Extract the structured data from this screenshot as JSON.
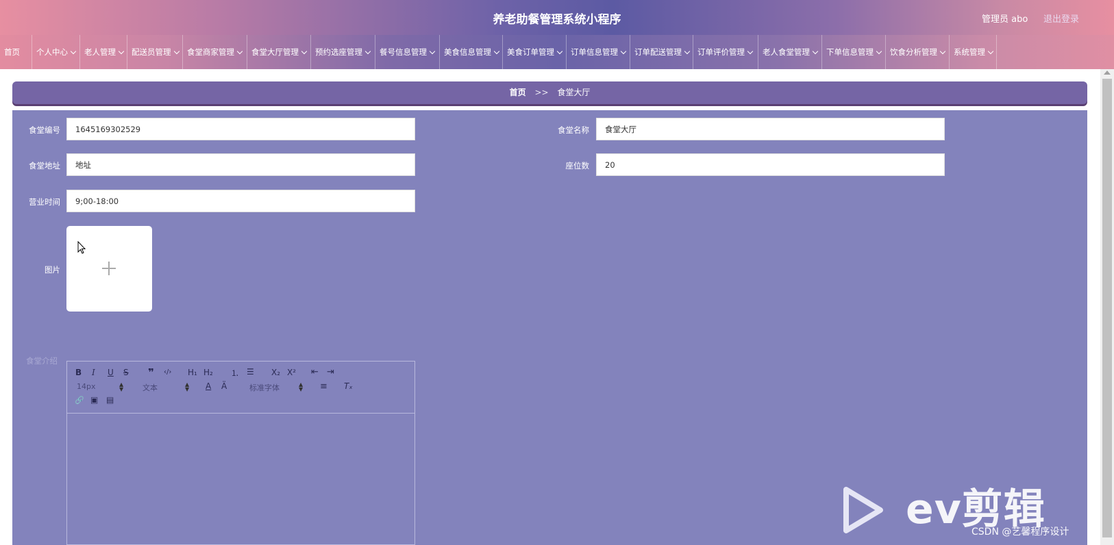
{
  "header": {
    "title": "养老助餐管理系统小程序",
    "user": "管理员 abo",
    "logout": "退出登录"
  },
  "nav": {
    "items": [
      {
        "label": "首页",
        "chevron": false
      },
      {
        "label": "个人中心",
        "chevron": true
      },
      {
        "label": "老人管理",
        "chevron": true
      },
      {
        "label": "配送员管理",
        "chevron": true
      },
      {
        "label": "食堂商家管理",
        "chevron": true
      },
      {
        "label": "食堂大厅管理",
        "chevron": true
      },
      {
        "label": "预约选座管理",
        "chevron": true
      },
      {
        "label": "餐号信息管理",
        "chevron": true
      },
      {
        "label": "美食信息管理",
        "chevron": true
      },
      {
        "label": "美食订单管理",
        "chevron": true
      },
      {
        "label": "订单信息管理",
        "chevron": true
      },
      {
        "label": "订单配送管理",
        "chevron": true
      },
      {
        "label": "订单评价管理",
        "chevron": true
      },
      {
        "label": "老人食堂管理",
        "chevron": true
      },
      {
        "label": "下单信息管理",
        "chevron": true
      },
      {
        "label": "饮食分析管理",
        "chevron": true
      },
      {
        "label": "系统管理",
        "chevron": true
      }
    ]
  },
  "breadcrumb": {
    "home": "首页",
    "sep": ">>",
    "current": "食堂大厅"
  },
  "form": {
    "canteen_no_label": "食堂编号",
    "canteen_no": "1645169302529",
    "canteen_name_label": "食堂名称",
    "canteen_name": "食堂大厅",
    "address_label": "食堂地址",
    "address": "地址",
    "seats_label": "座位数",
    "seats": "20",
    "hours_label": "营业时间",
    "hours": "9;00-18:00",
    "image_label": "图片",
    "intro_label": "食堂介绍"
  },
  "editor": {
    "font_size": "14px",
    "block_format": "文本",
    "font_family": "标准字体",
    "bold": "B",
    "italic": "I",
    "underline": "U",
    "strike": "S",
    "quote": "❞",
    "code": "‹/›",
    "h1": "H₁",
    "h2": "H₂",
    "ol": "⒈",
    "ul": "☰",
    "sub": "X₂",
    "sup": "X²",
    "indent_dec": "⇤",
    "indent_inc": "⇥",
    "color": "A",
    "bg_color": "Ä",
    "align": "≡",
    "clear": "Tₓ",
    "link": "🔗",
    "image": "▣",
    "video": "▤"
  },
  "watermark": {
    "brand": "ev剪辑",
    "credit": "CSDN @艺馨程序设计"
  }
}
